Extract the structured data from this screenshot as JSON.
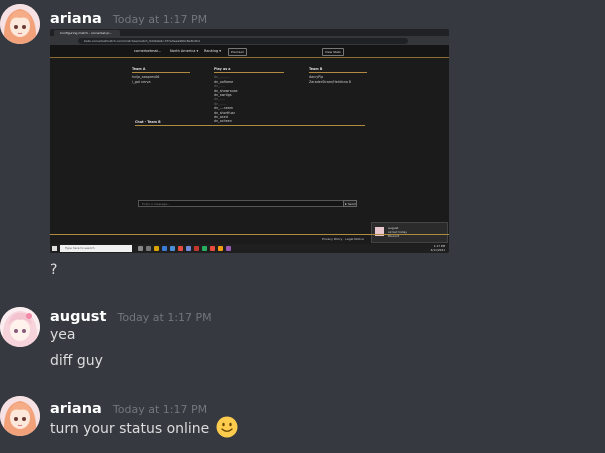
{
  "messages": [
    {
      "username": "ariana",
      "timestamp": "Today at 1:17 PM",
      "attachment": {
        "browser_tab": "Configuring match - cornerbet.pr...",
        "url": "beta.cornerbetmatch.com/matches/match_9d42ab9c-f37a3eea960c8e3b3bd",
        "nav": {
          "brand": "cornerbetmat...",
          "region": "North America ▾",
          "ranking": "Ranking ▾",
          "premium": "Premium",
          "view_stats": "View Stats"
        },
        "team_a": {
          "title": "Team A",
          "players": [
            "hnija_aaaprev06",
            "i_got nerva"
          ]
        },
        "play_as": {
          "title": "Play as a",
          "options": [
            "dn_..........",
            "dn_ooflame",
            "dn_.....",
            "dn_showrause",
            "dn_swrtlgs",
            "dn_.....",
            "dn_......",
            "dn_....seam",
            "dn_shortfuzz",
            "dn_aced",
            "dn_ocheen"
          ]
        },
        "team_b": {
          "title": "Team B",
          "players": [
            "darcyPlp",
            "ZaraderStram/Heldinna 8"
          ]
        },
        "chat_title": "Chat - Team B",
        "chat_placeholder": "Enter a message...",
        "send_label": "➤ Send",
        "footer": "Privacy Policy · Legal Notice",
        "toast": {
          "title": "august",
          "line1": "ok but today",
          "line2": "Discord"
        },
        "taskbar_search": "Type here to search",
        "clock_time": "1:17 PM",
        "clock_date": "4/11/2021"
      },
      "text": "?"
    },
    {
      "username": "august",
      "timestamp": "Today at 1:17 PM",
      "lines": [
        "yea",
        "diff guy"
      ]
    },
    {
      "username": "ariana",
      "timestamp": "Today at 1:17 PM",
      "text": "turn your status online",
      "emoji": "slightly-smiling-face"
    }
  ]
}
